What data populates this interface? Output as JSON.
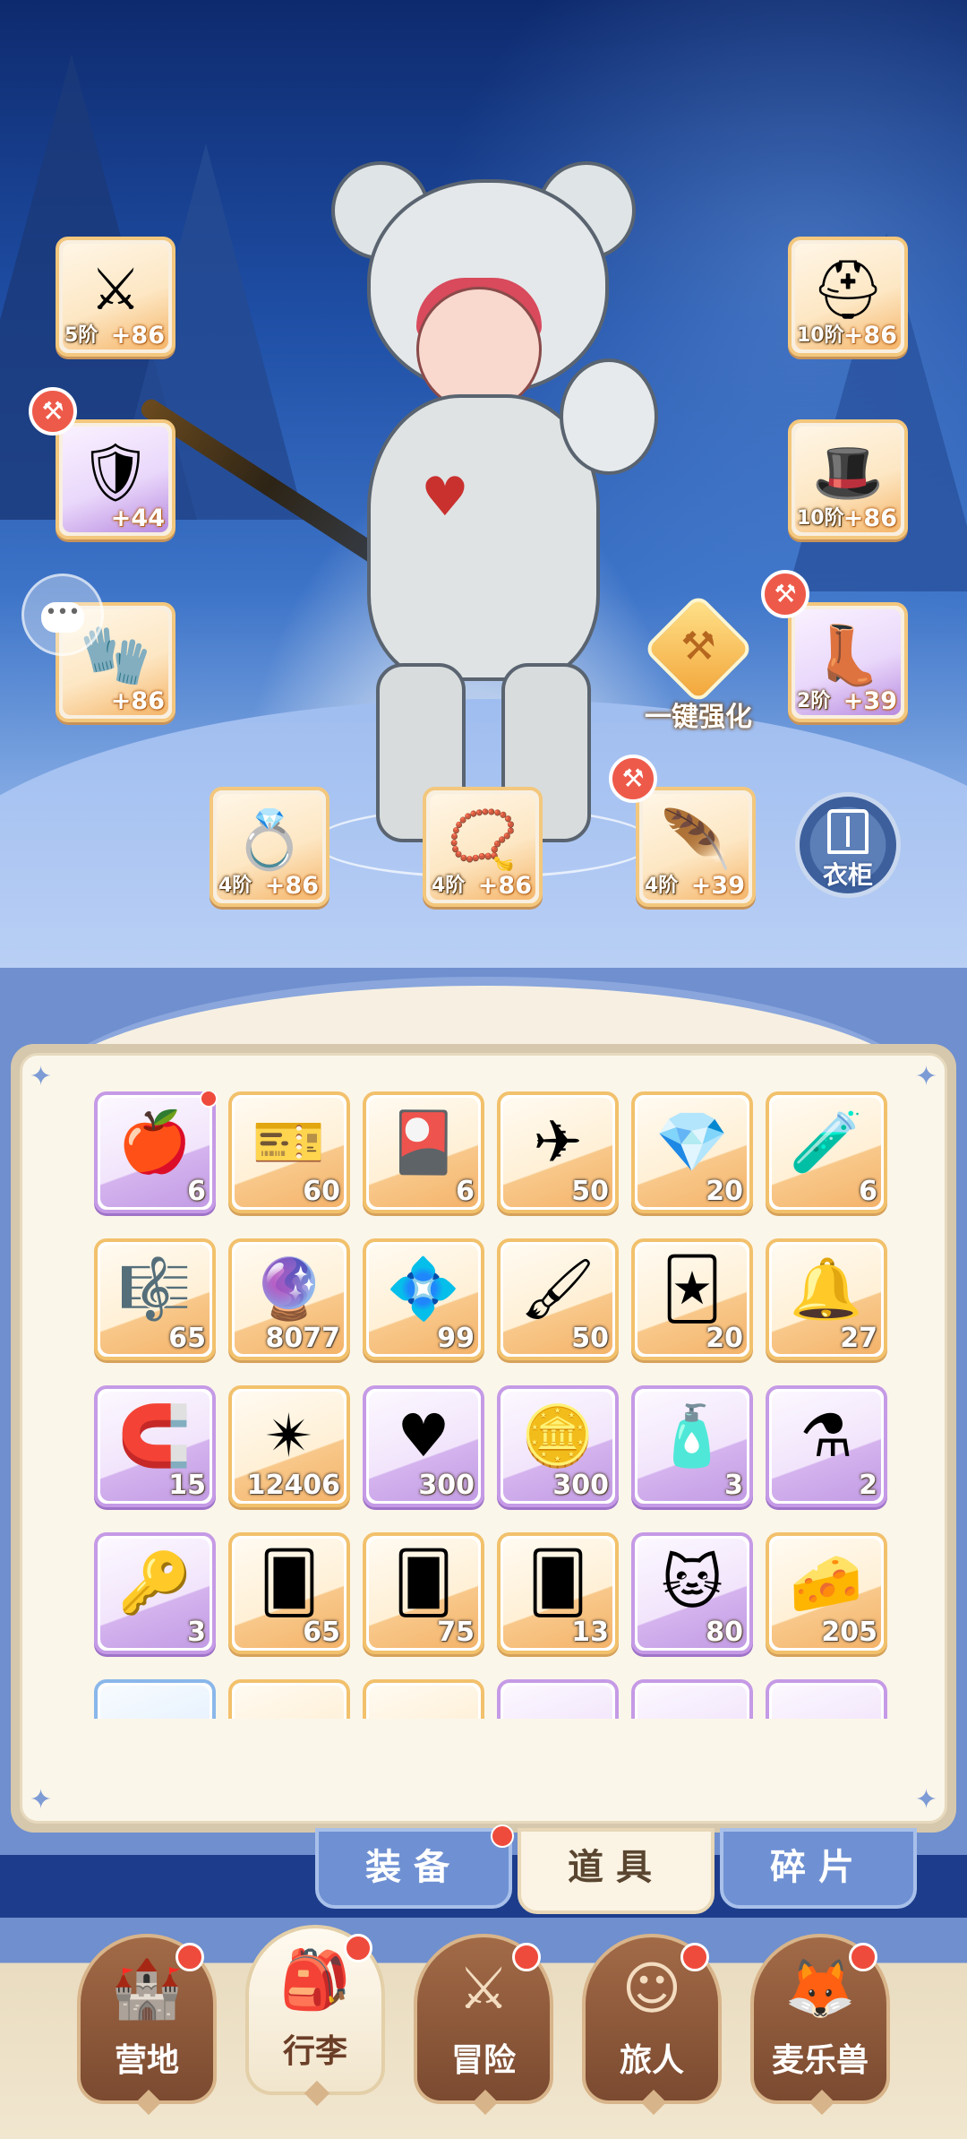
{
  "equipment": {
    "weapon": {
      "tier": "5阶",
      "plus": "+86",
      "icon": "axe-icon",
      "glyph": "⚔"
    },
    "armor": {
      "tier": "",
      "plus": "+44",
      "icon": "armor-icon",
      "glyph": "🛡",
      "badge": true
    },
    "bracers": {
      "tier": "",
      "plus": "+86",
      "icon": "bracers-icon",
      "glyph": "🧤"
    },
    "helmet": {
      "tier": "10阶",
      "plus": "+86",
      "icon": "helmet-icon",
      "glyph": "⛑"
    },
    "helmet2": {
      "tier": "10阶",
      "plus": "+86",
      "icon": "hood-icon",
      "glyph": "🎩"
    },
    "boots": {
      "tier": "2阶",
      "plus": "+39",
      "icon": "boots-icon",
      "glyph": "👢",
      "badge": true
    },
    "ring": {
      "tier": "4阶",
      "plus": "+86",
      "icon": "ring-icon",
      "glyph": "💍"
    },
    "necklace": {
      "tier": "4阶",
      "plus": "+86",
      "icon": "necklace-icon",
      "glyph": "📿"
    },
    "earring": {
      "tier": "4阶",
      "plus": "+39",
      "icon": "earring-icon",
      "glyph": "🪶",
      "badge": true
    }
  },
  "actions": {
    "enhance_label": "一键强化",
    "wardrobe_label": "衣柜"
  },
  "inventory": [
    {
      "icon": "apple-icon",
      "glyph": "🍎",
      "count": "6",
      "rarity": "purple",
      "dot": true
    },
    {
      "icon": "ticket-icon",
      "glyph": "🎫",
      "count": "60",
      "rarity": "orange"
    },
    {
      "icon": "card-icon",
      "glyph": "🎴",
      "count": "6",
      "rarity": "orange"
    },
    {
      "icon": "paper-plane-icon",
      "glyph": "✈",
      "count": "50",
      "rarity": "orange"
    },
    {
      "icon": "amber-gem-icon",
      "glyph": "💎",
      "count": "20",
      "rarity": "orange"
    },
    {
      "icon": "blue-potion-icon",
      "glyph": "🧪",
      "count": "6",
      "rarity": "orange"
    },
    {
      "icon": "harp-icon",
      "glyph": "🎼",
      "count": "65",
      "rarity": "orange"
    },
    {
      "icon": "portal-orb-icon",
      "glyph": "🔮",
      "count": "8077",
      "rarity": "orange"
    },
    {
      "icon": "crystal-icon",
      "glyph": "💠",
      "count": "99",
      "rarity": "orange"
    },
    {
      "icon": "paint-tube-icon",
      "glyph": "🖌",
      "count": "50",
      "rarity": "orange"
    },
    {
      "icon": "outfit-card-icon",
      "glyph": "🃏",
      "count": "20",
      "rarity": "orange"
    },
    {
      "icon": "bell-icon",
      "glyph": "🔔",
      "count": "27",
      "rarity": "orange"
    },
    {
      "icon": "horseshoe-icon",
      "glyph": "🧲",
      "count": "15",
      "rarity": "purple"
    },
    {
      "icon": "star-crystal-icon",
      "glyph": "✴",
      "count": "12406",
      "rarity": "orange"
    },
    {
      "icon": "heart-icon",
      "glyph": "♥",
      "count": "300",
      "rarity": "purple"
    },
    {
      "icon": "heart-coin-icon",
      "glyph": "🪙",
      "count": "300",
      "rarity": "purple"
    },
    {
      "icon": "blue-bottle-icon",
      "glyph": "🧴",
      "count": "3",
      "rarity": "purple"
    },
    {
      "icon": "red-potion-icon",
      "glyph": "⚗",
      "count": "2",
      "rarity": "purple"
    },
    {
      "icon": "key-icon",
      "glyph": "🔑",
      "count": "3",
      "rarity": "purple"
    },
    {
      "icon": "blue-card-icon",
      "glyph": "🂠",
      "count": "65",
      "rarity": "orange"
    },
    {
      "icon": "gold-card-icon",
      "glyph": "🂠",
      "count": "75",
      "rarity": "orange"
    },
    {
      "icon": "red-card-icon",
      "glyph": "🂠",
      "count": "13",
      "rarity": "orange"
    },
    {
      "icon": "cat-mirror-icon",
      "glyph": "🐱",
      "count": "80",
      "rarity": "purple"
    },
    {
      "icon": "cheese-icon",
      "glyph": "🧀",
      "count": "205",
      "rarity": "orange"
    },
    {
      "icon": "item-icon",
      "glyph": "",
      "count": "",
      "rarity": "blue"
    },
    {
      "icon": "item-icon",
      "glyph": "",
      "count": "",
      "rarity": "orange"
    },
    {
      "icon": "item-icon",
      "glyph": "",
      "count": "",
      "rarity": "orange"
    },
    {
      "icon": "item-icon",
      "glyph": "",
      "count": "",
      "rarity": "purple"
    },
    {
      "icon": "item-icon",
      "glyph": "",
      "count": "",
      "rarity": "purple"
    },
    {
      "icon": "item-icon",
      "glyph": "",
      "count": "",
      "rarity": "purple"
    }
  ],
  "tabs": [
    {
      "label": "装备",
      "active": false,
      "dot": true
    },
    {
      "label": "道具",
      "active": true,
      "dot": false
    },
    {
      "label": "碎片",
      "active": false,
      "dot": false
    }
  ],
  "nav": [
    {
      "label": "营地",
      "icon": "castle-icon",
      "glyph": "🏰",
      "active": false
    },
    {
      "label": "行李",
      "icon": "backpack-icon",
      "glyph": "🎒",
      "active": true
    },
    {
      "label": "冒险",
      "icon": "swords-icon",
      "glyph": "⚔",
      "active": false
    },
    {
      "label": "旅人",
      "icon": "traveler-icon",
      "glyph": "☺",
      "active": false
    },
    {
      "label": "麦乐兽",
      "icon": "pet-icon",
      "glyph": "🦊",
      "active": false
    }
  ],
  "colors": {
    "accent": "#f2c16c",
    "rare": "#c59ae6",
    "notify": "#ef4b3c"
  }
}
